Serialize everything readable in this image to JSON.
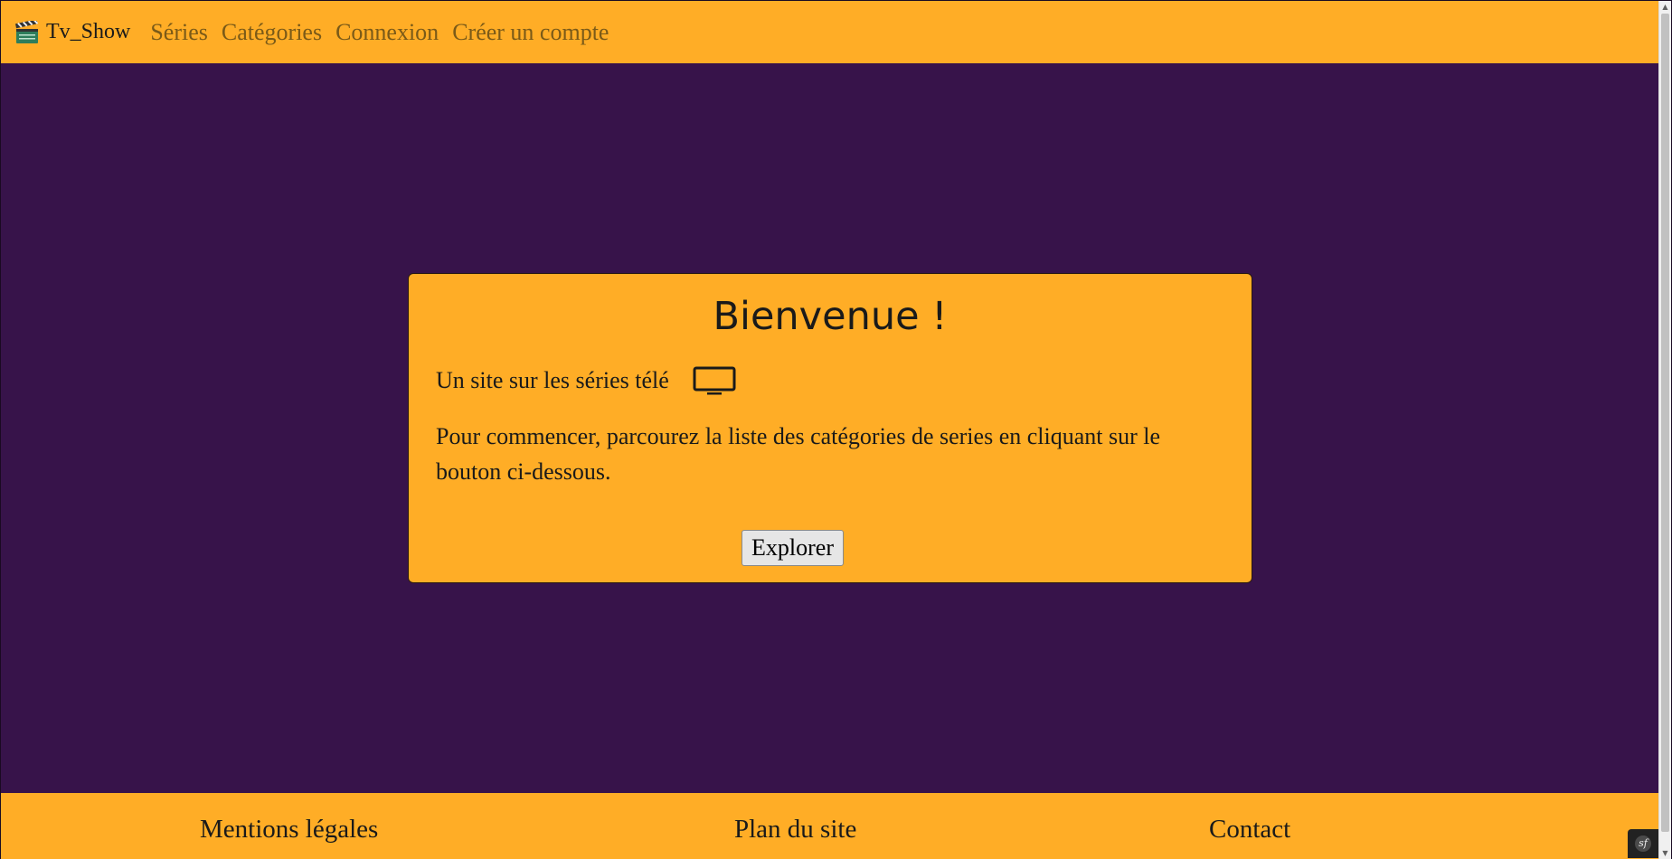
{
  "navbar": {
    "brand": {
      "icon": "clapperboard-icon",
      "label": "Tv_Show"
    },
    "links": [
      {
        "label": "Séries"
      },
      {
        "label": "Catégories"
      },
      {
        "label": "Connexion"
      },
      {
        "label": "Créer un compte"
      }
    ]
  },
  "welcome": {
    "title": "Bienvenue !",
    "tagline": "Un site sur les séries télé",
    "tagline_icon": "tv-icon",
    "intro": "Pour commencer, parcourez la liste des catégories de series en cliquant sur le bouton ci-dessous.",
    "button_label": "Explorer"
  },
  "footer": {
    "links": [
      {
        "label": "Mentions légales"
      },
      {
        "label": "Plan du site"
      },
      {
        "label": "Contact"
      }
    ]
  },
  "debug_toolbar": {
    "icon": "symfony-logo-icon",
    "label": "sf"
  },
  "colors": {
    "accent": "#ffad26",
    "background": "#37134a",
    "nav_link": "#7a5a18"
  }
}
